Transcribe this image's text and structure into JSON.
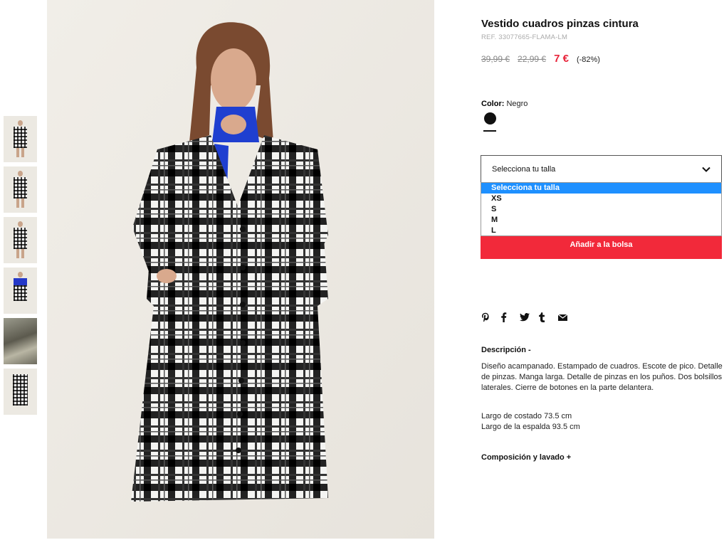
{
  "product": {
    "title": "Vestido cuadros pinzas cintura",
    "ref": "REF. 33077665-FLAMA-LM",
    "price_original": "39,99 €",
    "price_previous": "22,99 €",
    "price_current": "7 €",
    "discount": "(-82%)"
  },
  "color": {
    "label": "Color:",
    "value": "Negro",
    "swatch_hex": "#111111"
  },
  "size_select": {
    "placeholder": "Selecciona tu talla",
    "options": [
      "Selecciona tu talla",
      "XS",
      "S",
      "M",
      "L"
    ],
    "highlighted": "Selecciona tu talla",
    "highlight_color": "#1e90ff"
  },
  "add_to_bag": {
    "label": "Añadir a la bolsa",
    "color": "#f2293a"
  },
  "share_icons": [
    "pinterest-icon",
    "facebook-icon",
    "twitter-icon",
    "tumblr-icon",
    "email-icon"
  ],
  "description": {
    "heading": "Descripción -",
    "body": "Diseño acampanado. Estampado de cuadros. Escote de pico. Detalle de pinzas. Manga larga. Detalle de pinzas en los puños. Dos bolsillos laterales. Cierre de botones en la parte delantera.",
    "measure_1": "Largo de costado 73.5 cm",
    "measure_2": "Largo de la espalda 93.5 cm"
  },
  "composition": {
    "heading": "Composición y lavado +"
  },
  "gallery": {
    "thumbnails": [
      "front",
      "side",
      "back",
      "detail",
      "street",
      "flat"
    ]
  }
}
